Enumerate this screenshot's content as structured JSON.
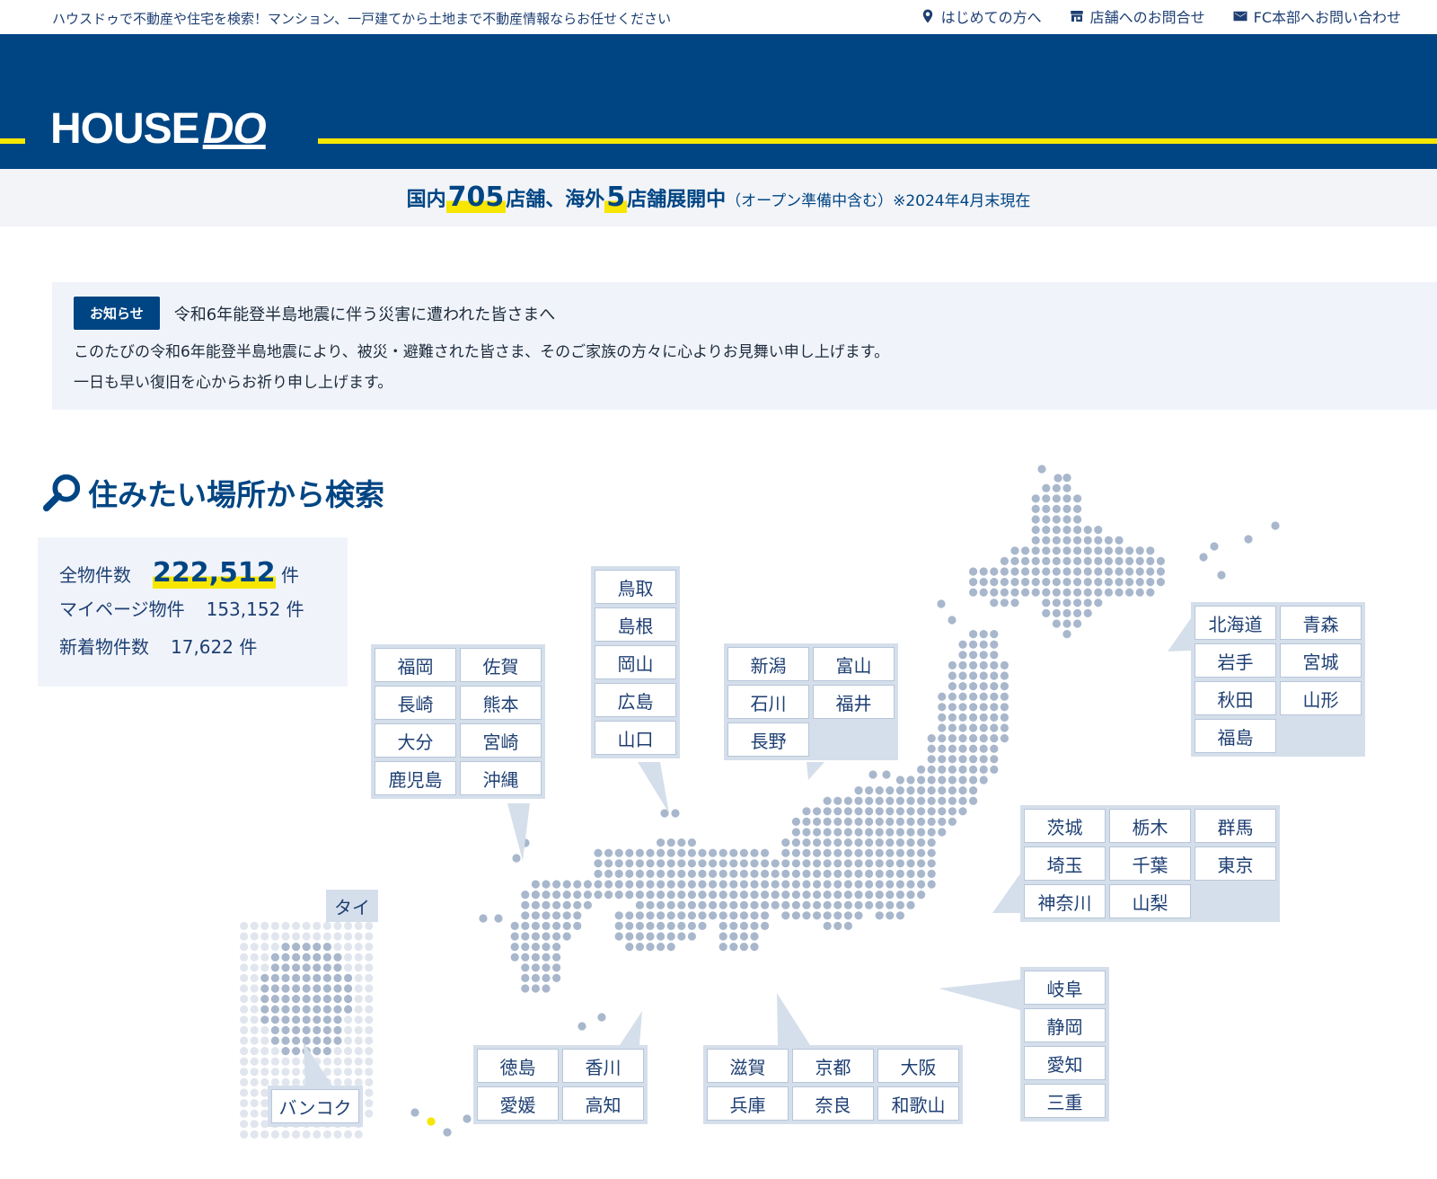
{
  "topbar": {
    "tagline": "ハウスドゥで不動産や住宅を検索！マンション、一戸建てから土地まで不動産情報ならお任せください",
    "links": [
      {
        "label": "はじめての方へ",
        "icon": "map-pin-icon"
      },
      {
        "label": "店舗へのお問合せ",
        "icon": "store-icon"
      },
      {
        "label": "FC本部へお問い合わせ",
        "icon": "mail-icon"
      }
    ]
  },
  "header": {
    "logo_house": "HOUSE",
    "logo_do": "DO",
    "brand_color": "#004583",
    "accent_color": "#f6e600"
  },
  "stores": {
    "prefix": "国内",
    "domestic": "705",
    "middle": "店舗、海外",
    "overseas": "5",
    "suffix": "店舗展開中",
    "note": "（オープン準備中含む）※2024年4月末現在"
  },
  "notice": {
    "badge": "お知らせ",
    "title": "令和6年能登半島地震に伴う災害に遭われた皆さまへ",
    "line1": "このたびの令和6年能登半島地震により、被災・避難された皆さま、そのご家族の方々に心よりお見舞い申し上げます。",
    "line2": "一日も早い復旧を心からお祈り申し上げます。"
  },
  "search": {
    "heading": "住みたい場所から検索",
    "icon": "search-icon"
  },
  "counts": {
    "all_label": "全物件数",
    "all_value": "222,512",
    "all_unit": "件",
    "mypage_label": "マイページ物件",
    "mypage_value": "153,152 件",
    "new_label": "新着物件数",
    "new_value": "17,622 件"
  },
  "regions": {
    "kyushu": [
      "福岡",
      "佐賀",
      "長崎",
      "熊本",
      "大分",
      "宮崎",
      "鹿児島",
      "沖縄"
    ],
    "chugoku": [
      "鳥取",
      "島根",
      "岡山",
      "広島",
      "山口"
    ],
    "hokuriku": [
      "新潟",
      "富山",
      "石川",
      "福井",
      "長野"
    ],
    "tohoku": [
      "北海道",
      "青森",
      "岩手",
      "宮城",
      "秋田",
      "山形",
      "福島"
    ],
    "kanto": [
      "茨城",
      "栃木",
      "群馬",
      "埼玉",
      "千葉",
      "東京",
      "神奈川",
      "山梨"
    ],
    "tokai": [
      "岐阜",
      "静岡",
      "愛知",
      "三重"
    ],
    "shikoku": [
      "徳島",
      "香川",
      "愛媛",
      "高知"
    ],
    "kinki": [
      "滋賀",
      "京都",
      "大阪",
      "兵庫",
      "奈良",
      "和歌山"
    ],
    "thailand_label": "タイ",
    "thailand": [
      "バンコク"
    ]
  }
}
